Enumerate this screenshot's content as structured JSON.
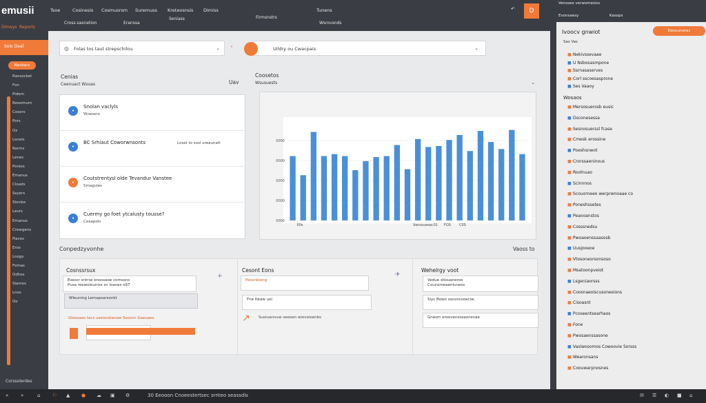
{
  "sidebar": {
    "brand": "emusii",
    "tabs": [
      "Dimeys",
      "Reports"
    ],
    "strip_label": "Solo Deal",
    "pill_label": "Navbars",
    "items": [
      "Ransocket",
      "Fon",
      "Pidem",
      "Rossimum",
      "Cosers",
      "Pors",
      "Oz",
      "Loneis",
      "Rorms",
      "Lenes",
      "Poress",
      "Emanus",
      "Cloads",
      "Ssyers",
      "Slovies",
      "Leurs",
      "Emanus",
      "Crewgens",
      "Fiaces",
      "Eros",
      "Lnogs",
      "Fomas",
      "Odhos",
      "Slamos",
      "Lnos",
      "Oo"
    ],
    "footer": "Corssolerdes"
  },
  "topbar": {
    "items": [
      "Tsoe",
      "Cosinesis",
      "Cosmusrsm",
      "Suremuss",
      "Kreteosnsis",
      "Dimiss",
      "Tunens"
    ],
    "button_glyph": "D",
    "sub_items": [
      "Cross-sasnetion",
      "Eranssa",
      "Seniass",
      "Firmsnstrs",
      "Wsrovsnds"
    ]
  },
  "address_left": {
    "text": "Folas tos taut strepschilou"
  },
  "address_right": {
    "text": "Uildry ou Cwacpais"
  },
  "left_section": {
    "title": "Cenias",
    "subtitle": "Ceenuact Wsuas",
    "items": [
      {
        "title": "Snolan vaclyls",
        "subtitle": "Wnesers",
        "right": "",
        "color": "#3b7dd8"
      },
      {
        "title": "BC Srhiaut Coworwnsonts",
        "subtitle": "",
        "right": "Loset to sosi ureaunalt",
        "color": "#3b7dd8"
      },
      {
        "title": "Coutstrentysl olde Tevandur Vanstee",
        "subtitle": "Smaguies",
        "right": "",
        "color": "#f07a3a"
      },
      {
        "title": "Cuermy go foet ytcalusty tousse?",
        "subtitle": "Ceaapols",
        "right": "",
        "color": "#3b7dd8"
      }
    ]
  },
  "chart_section": {
    "title": "Coosetos",
    "subtitle": "Wsusuests",
    "badge": "Uav"
  },
  "chart_data": {
    "type": "bar",
    "title": "",
    "xlabel": "",
    "ylabel": "",
    "y_ticks": [
      "0000",
      "0000",
      "0000",
      "0000",
      "0000"
    ],
    "x_labels": [
      "00s",
      "Vanssuwaa:01",
      "FOS",
      "C0S"
    ],
    "values": [
      64,
      45,
      88,
      64,
      66,
      64,
      50,
      59,
      63,
      64,
      75,
      51,
      81,
      73,
      74,
      80,
      85,
      69,
      89,
      78,
      71,
      90,
      66
    ],
    "ylim": [
      0,
      100
    ],
    "color": "#4a90d9",
    "value_labels": [
      "",
      "",
      "",
      "",
      "",
      "",
      "",
      "",
      "",
      "",
      "",
      "",
      "",
      "",
      "",
      "",
      "",
      "",
      "",
      "",
      "",
      "",
      ""
    ]
  },
  "bottom_section": {
    "title": "Conpedzyvonhe",
    "right_label": "Vaoss to",
    "col1": {
      "head": "Cosnssrsux",
      "field1": "Esessr sntrse enossaoe cornssns",
      "field1b": "Pusa reewoiouniss sn loanes o97",
      "field2": "Wleuning Lemapsarsonkt",
      "orange": "Gtessaas tecs useisnoienaw Ssosnn Gaeuaes"
    },
    "col2": {
      "head": "Cesont Eons",
      "field1": "Pessnbiong",
      "field2": "Fne Iteaw uoi",
      "orange": "Susiuarsvue seeoen wiovoioenbs"
    },
    "col3": {
      "head": "Wehelrgy voot",
      "field1": "Vedue stiouaneroo",
      "field1b": "Coursiroeaeniuness",
      "field2": "Siyc Bowo osconcsoeciw",
      "field3": "Gnesm eroovensoseonsnae"
    }
  },
  "right_panel": {
    "top_items": [
      "Venssee verwomesiss",
      "Evonsaesy",
      "Kasops"
    ],
    "title": "Ivoocv gnwiot",
    "button": "Dosounerez",
    "sub": "Sas  Vas",
    "head1": "Wosaos",
    "rows_a": [
      "Nekivssevaae",
      "U Nsbosasmpone",
      "Ssrnasaserves",
      "Corl sscoesasprone",
      "Ses Vaaoy"
    ],
    "rows_b": [
      "Mersosuerosb eusic",
      "Dsconesessa",
      "Sesnosuerssl fcase",
      "Cmesk erossine",
      "Poeshsnwot",
      "Crorssaeninous",
      "Roolnuao",
      "Scinnnos",
      "Scouorneeo werprwnoaae co",
      "Poneshssetes",
      "Peaooanstos",
      "Cosssnedsu",
      "Pwoaoenssaasosb",
      "Uusjooeoe",
      "Vtosoneorsonsoso",
      "Msatoonpveiot",
      "Lsgeniaorsss",
      "Coosnaeoiscusonesions",
      "Cisoasnt",
      "Pcoseentsearhaos",
      "Fone",
      "Pwosaenssasone",
      "Vasiwosomos Cowoovie Sorsss",
      "Wearonsans",
      "Coouwarpnosnes"
    ]
  },
  "taskbar": {
    "items": [
      "«",
      "»",
      "⌂",
      "⚐",
      "▲",
      "●",
      "☁",
      "▣",
      "⚙",
      "30 Eeooon Cnoeestertsec srnteo seassdis"
    ],
    "right": [
      "✉",
      "☰",
      "◐",
      "■",
      "⌂"
    ]
  },
  "colors": {
    "accent": "#f07a3a",
    "blue": "#4a90d9",
    "panel": "#3a3d43"
  }
}
